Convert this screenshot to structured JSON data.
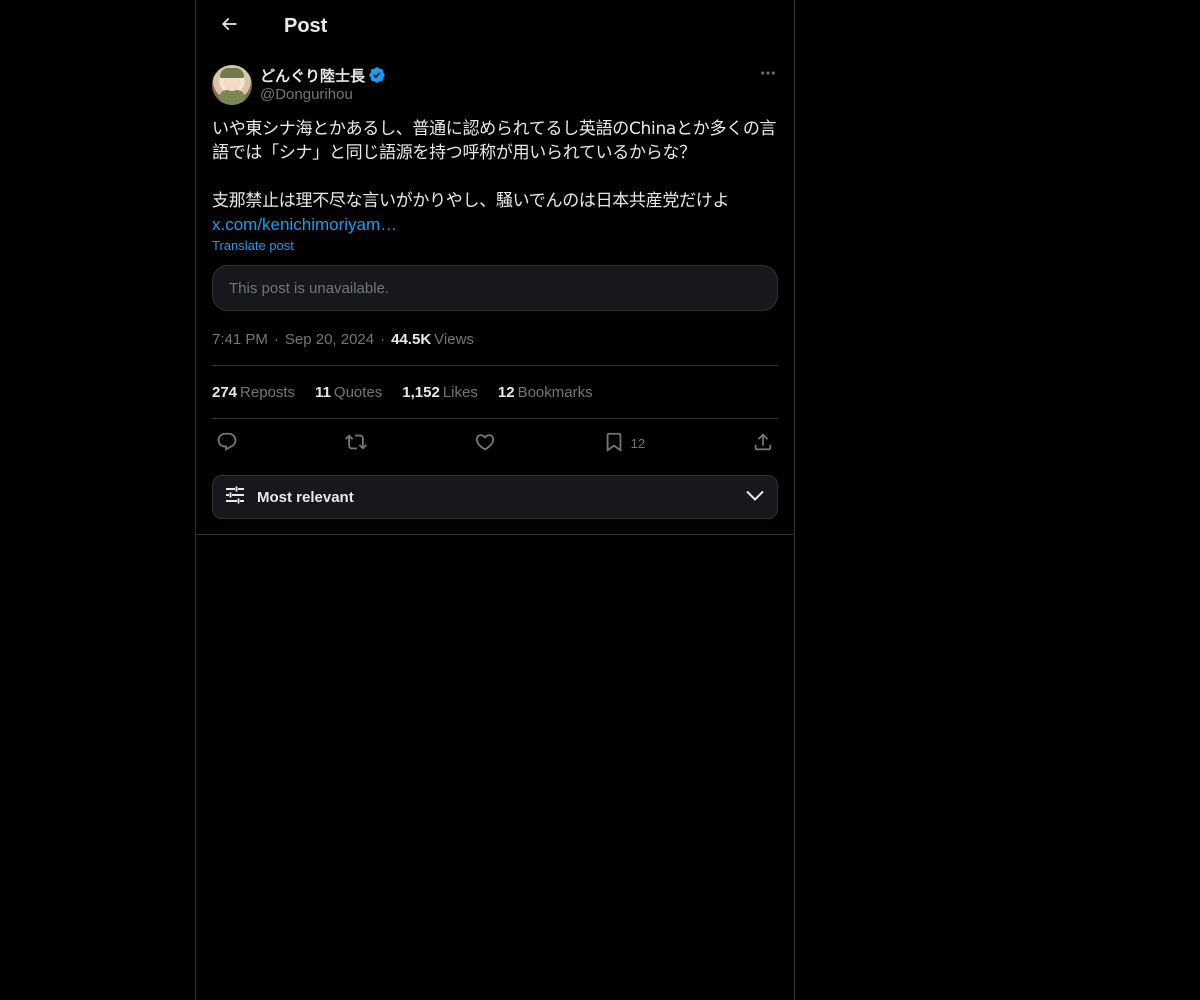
{
  "header": {
    "title": "Post",
    "back_icon": "arrow-left-icon"
  },
  "author": {
    "display_name": "どんぐり陸士長",
    "handle": "@Dongurihou",
    "verified": true,
    "verified_color": "#1d9bf0"
  },
  "post": {
    "text": "いや東シナ海とかあるし、普通に認められてるし英語のChinaとか多くの言語では「シナ」と同じ語源を持つ呼称が用いられているからな？\n\n支那禁止は理不尽な言いがかりやし、騒いでんのは日本共産党だけよ",
    "link": "x.com/kenichimoriyam…",
    "translate_label": "Translate post",
    "quoted_unavailable": "This post is unavailable."
  },
  "meta": {
    "time": "7:41 PM",
    "separator": "·",
    "date": "Sep 20, 2024",
    "views_count": "44.5K",
    "views_label": "Views"
  },
  "stats": {
    "reposts_count": "274",
    "reposts_label": "Reposts",
    "quotes_count": "11",
    "quotes_label": "Quotes",
    "likes_count": "1,152",
    "likes_label": "Likes",
    "bookmarks_count": "12",
    "bookmarks_label": "Bookmarks"
  },
  "actions": {
    "reply_icon": "reply-icon",
    "repost_icon": "repost-icon",
    "like_icon": "heart-icon",
    "bookmark_icon": "bookmark-icon",
    "bookmark_count": "12",
    "share_icon": "share-icon"
  },
  "sort": {
    "label": "Most relevant",
    "icon": "sliders-icon",
    "chevron": "chevron-down-icon"
  },
  "colors": {
    "background": "#000000",
    "text": "#e7e9ea",
    "muted": "#71767b",
    "accent": "#1d9bf0",
    "border": "#2f3336"
  }
}
